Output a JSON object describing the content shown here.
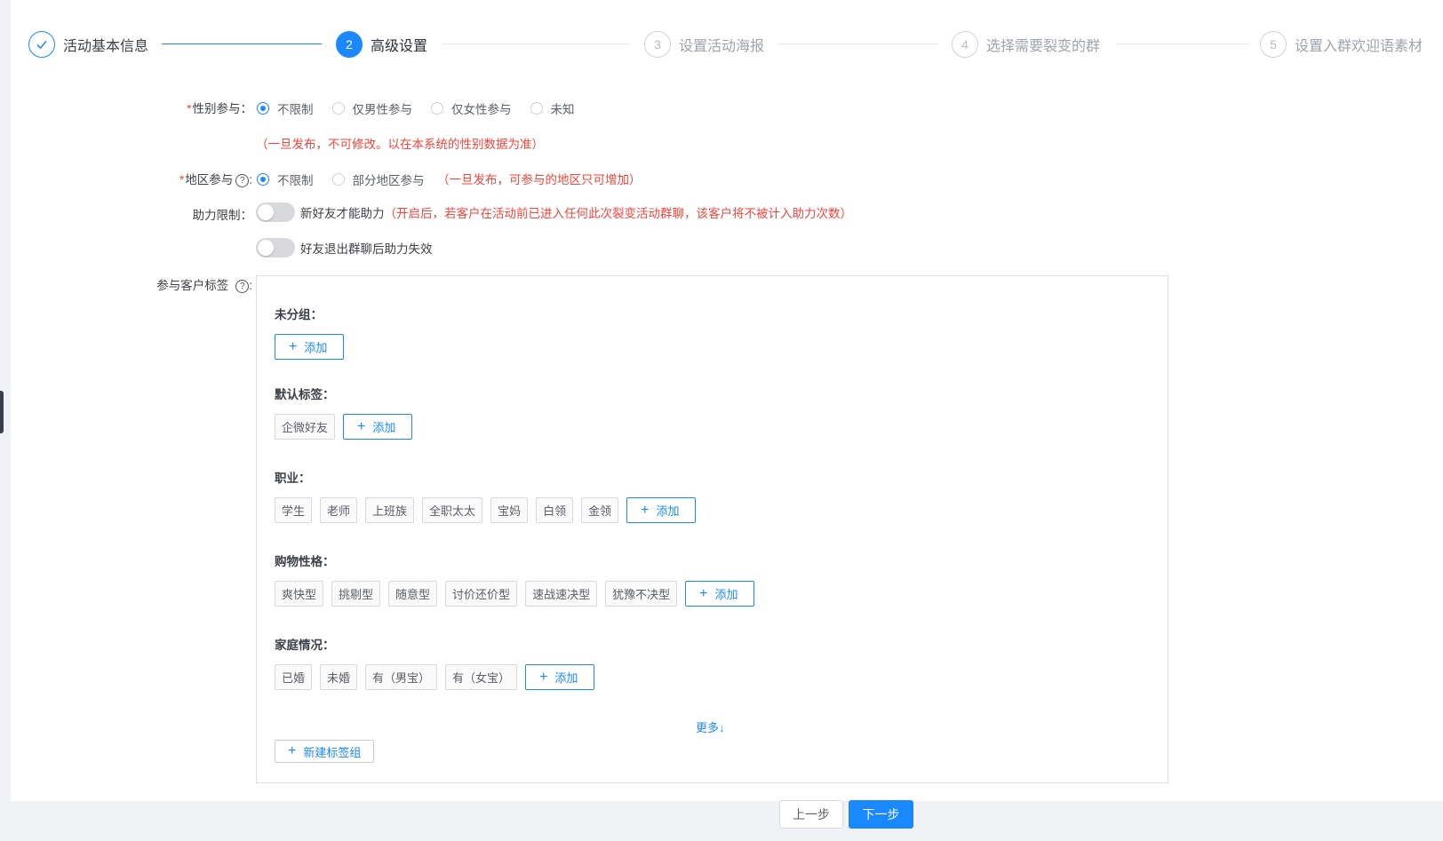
{
  "steps": [
    {
      "num": "1",
      "title": "活动基本信息",
      "state": "done"
    },
    {
      "num": "2",
      "title": "高级设置",
      "state": "active"
    },
    {
      "num": "3",
      "title": "设置活动海报",
      "state": "pending"
    },
    {
      "num": "4",
      "title": "选择需要裂变的群",
      "state": "pending"
    },
    {
      "num": "5",
      "title": "设置入群欢迎语素材",
      "state": "pending"
    }
  ],
  "gender": {
    "required_mark": "*",
    "label": "性别参与：",
    "options": [
      "不限制",
      "仅男性参与",
      "仅女性参与",
      "未知"
    ],
    "selected": "不限制",
    "warning": "（一旦发布，不可修改。以在本系统的性别数据为准）"
  },
  "region": {
    "required_mark": "*",
    "label": "地区参与",
    "help": "?",
    "colon": ":",
    "options": [
      "不限制",
      "部分地区参与"
    ],
    "selected": "不限制",
    "warning": "（一旦发布，可参与的地区只可增加）"
  },
  "assist": {
    "label": "助力限制：",
    "switch1_text": "新好友才能助力",
    "switch1_note": "（开启后，若客户在活动前已进入任何此次裂变活动群聊，该客户将不被计入助力次数）",
    "switch2_text": "好友退出群聊后助力失效"
  },
  "tags_section": {
    "label": "参与客户标签",
    "help": "?",
    "colon": ":",
    "add_label": "添加",
    "plus": "+",
    "groups": [
      {
        "title": "未分组：",
        "tags": []
      },
      {
        "title": "默认标签：",
        "tags": [
          "企微好友"
        ]
      },
      {
        "title": "职业：",
        "tags": [
          "学生",
          "老师",
          "上班族",
          "全职太太",
          "宝妈",
          "白领",
          "金领"
        ]
      },
      {
        "title": "购物性格：",
        "tags": [
          "爽快型",
          "挑剔型",
          "随意型",
          "讨价还价型",
          "速战速决型",
          "犹豫不决型"
        ]
      },
      {
        "title": "家庭情况：",
        "tags": [
          "已婚",
          "未婚",
          "有（男宝）",
          "有（女宝）"
        ]
      }
    ],
    "more": "更多↓",
    "new_group": "新建标签组"
  },
  "footer": {
    "prev": "上一步",
    "next": "下一步"
  },
  "colors": {
    "primary": "#1a89ff",
    "warning": "#f2463d"
  }
}
